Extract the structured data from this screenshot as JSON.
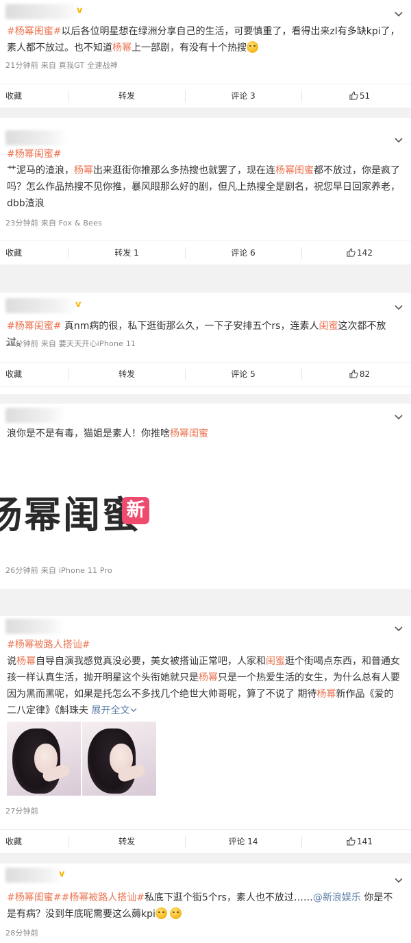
{
  "posts": [
    {
      "text": [
        {
          "t": "#杨幂闺蜜#",
          "c": "topic"
        },
        {
          "t": "以后各位明星想在绿洲分享自己的生活，可要慎重了，看得出来zl有多缺kpi了，素人都不放过。也不知道"
        },
        {
          "t": "杨幂",
          "c": "kw"
        },
        {
          "t": "上一部剧，有没有十个热搜"
        },
        {
          "emoji": "emoji-face"
        }
      ],
      "meta": "21分钟前  来自 真我GT 全速战神",
      "actions": {
        "collect": "收藏",
        "repost": "转发",
        "comment": "评论 3",
        "like": "51"
      }
    },
    {
      "text": [
        {
          "t": "#杨幂闺蜜#",
          "c": "topic"
        },
        {
          "br": true
        },
        {
          "t": "艹泥马的渣浪，"
        },
        {
          "t": "杨幂",
          "c": "kw"
        },
        {
          "t": "出来逛街你推那么多热搜也就罢了，现在连"
        },
        {
          "t": "杨幂闺蜜",
          "c": "kw"
        },
        {
          "t": "都不放过，你是疯了吗？怎么作品热搜不见你推，暴风眼那么好的剧，但凡上热搜全是剧名，祝您早日回家养老，dbb渣浪"
        }
      ],
      "meta": "23分钟前  来自 Fox & Bees",
      "actions": {
        "collect": "收藏",
        "repost": "转发 1",
        "comment": "评论 6",
        "like": "142"
      }
    },
    {
      "text": [
        {
          "t": "#杨幂闺蜜#",
          "c": "topic"
        },
        {
          "t": " 真nm病的很，私下逛街那么久，一下子安排五个rs，连素人"
        },
        {
          "t": "闺蜜",
          "c": "kw"
        },
        {
          "t": "这次都不放过。"
        }
      ],
      "meta": "26分钟前  来自 要天天开心iPhone 11",
      "actions": {
        "collect": "收藏",
        "repost": "转发",
        "comment": "评论 5",
        "like": "82"
      }
    },
    {
      "text": [
        {
          "t": "浪你是不是有毒，猫姐是素人！你推啥"
        },
        {
          "t": "杨幂闺蜜",
          "c": "kw"
        }
      ],
      "banner": {
        "text": "杨幂闺蜜",
        "badge": "新"
      },
      "meta": "26分钟前  来自 iPhone 11 Pro"
    },
    {
      "text": [
        {
          "t": "#杨幂被路人搭讪#",
          "c": "topic"
        },
        {
          "br": true
        },
        {
          "t": "说"
        },
        {
          "t": "杨幂",
          "c": "kw"
        },
        {
          "t": "自导自演我感觉真没必要，美女被搭讪正常吧，人家和"
        },
        {
          "t": "闺蜜",
          "c": "kw"
        },
        {
          "t": "逛个街喝点东西，和普通女孩一样认真生活，抛开明星这个头衔她就只是"
        },
        {
          "t": "杨幂",
          "c": "kw"
        },
        {
          "t": "只是一个热爱生活的女生，为什么总有人要因为黑而黑呢，如果是托怎么不多找几个绝世大帅哥呢，算了不说了 期待"
        },
        {
          "t": "杨幂",
          "c": "kw"
        },
        {
          "t": "新作品《爱的二八定律》《斛珠夫 "
        },
        {
          "t": "展开全文",
          "c": "blue"
        },
        {
          "chev": true
        }
      ],
      "meta": "27分钟前",
      "actions": {
        "collect": "收藏",
        "repost": "转发",
        "comment": "评论 14",
        "like": "141"
      }
    },
    {
      "text": [
        {
          "t": "#杨幂闺蜜#",
          "c": "topic"
        },
        {
          "t": "#杨幂被路人搭讪#",
          "c": "topic"
        },
        {
          "t": "私底下逛个街5个rs，素人也不放过……"
        },
        {
          "t": "@新浪娱乐",
          "c": "blue"
        },
        {
          "t": " 你是不是有病？没到年底呢需要这么薅kpi"
        },
        {
          "emoji": "emoji-face"
        },
        {
          "t": " "
        },
        {
          "emoji": "emoji-face"
        }
      ],
      "meta": "28分钟前"
    }
  ],
  "colors": {
    "topic": "#eb7350",
    "link": "#5d7fa8",
    "badge": "#ee4b6e",
    "verified": "#f7b500"
  }
}
